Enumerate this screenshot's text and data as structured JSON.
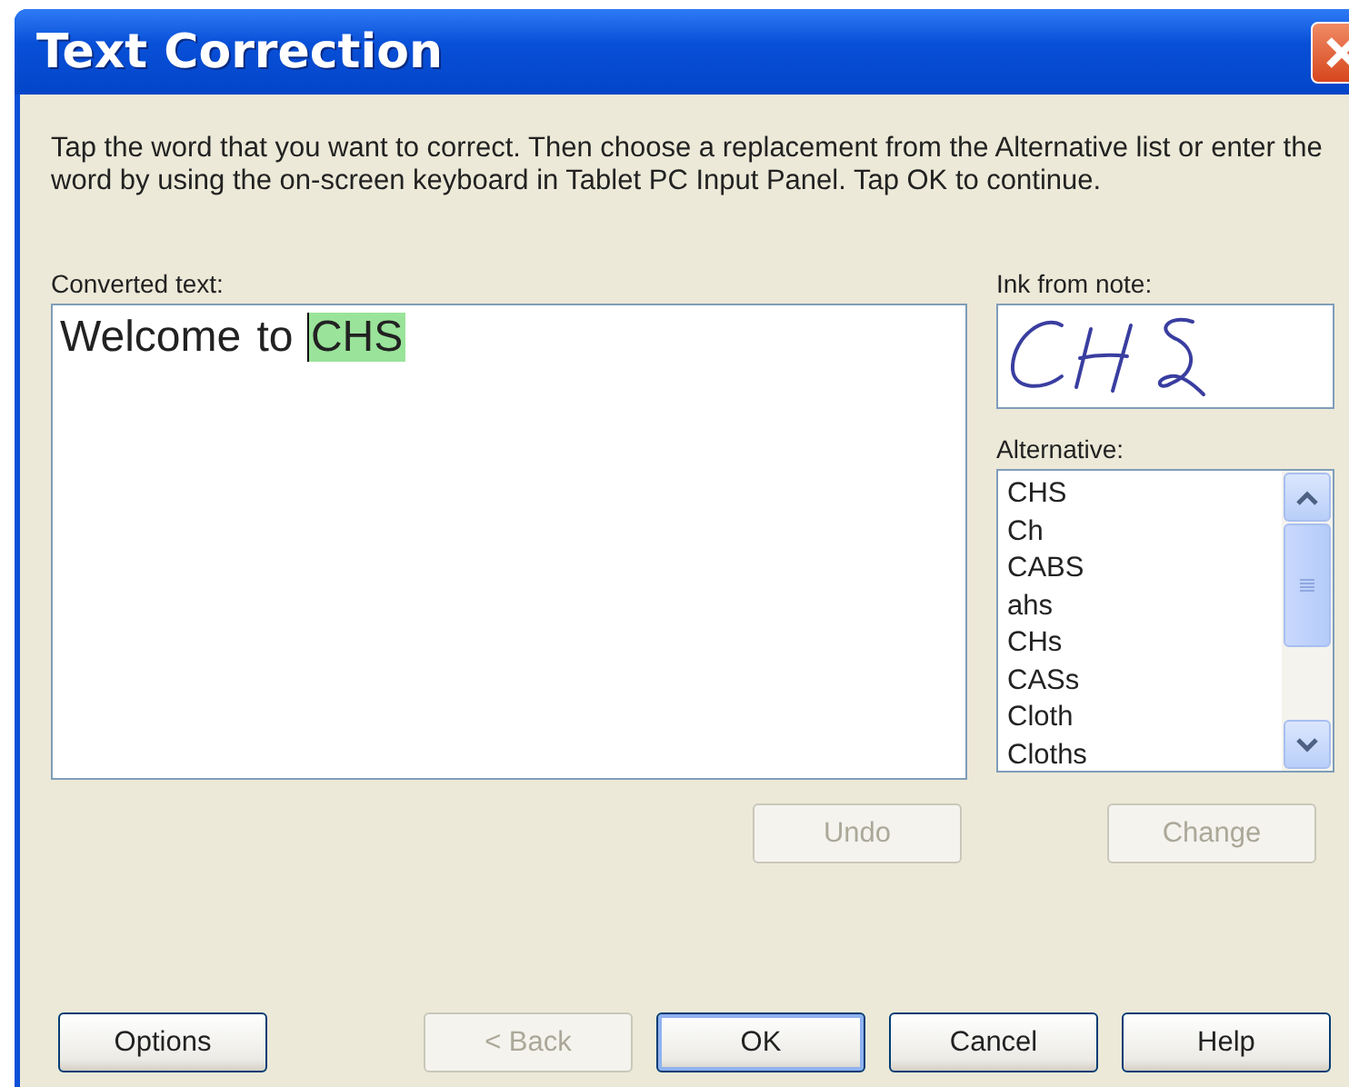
{
  "window": {
    "title": "Text Correction"
  },
  "instructions": "Tap the word that you want to correct. Then choose a replacement from the Alternative list or enter the word by using the on-screen keyboard in Tablet PC Input Panel. Tap OK to continue.",
  "converted_text": {
    "label": "Converted text:",
    "words": [
      {
        "text": "Welcome",
        "selected": false
      },
      {
        "text": "to",
        "selected": false
      },
      {
        "text": "CHS",
        "selected": true
      }
    ]
  },
  "ink": {
    "label": "Ink from note:"
  },
  "alternative": {
    "label": "Alternative:",
    "items": [
      {
        "text": "CHS",
        "selected": false
      },
      {
        "text": "Ch",
        "selected": false
      },
      {
        "text": "CABS",
        "selected": false
      },
      {
        "text": "ahs",
        "selected": false
      },
      {
        "text": "CHs",
        "selected": false
      },
      {
        "text": "CASs",
        "selected": false
      },
      {
        "text": "Cloth",
        "selected": false
      },
      {
        "text": "Cloths",
        "selected": false
      }
    ]
  },
  "undo_button": {
    "label": "Undo",
    "disabled": true
  },
  "change_button": {
    "label": "Change",
    "disabled": true
  },
  "buttons": [
    {
      "label": "Options",
      "disabled": false,
      "default": false
    },
    {
      "label": "< Back",
      "disabled": true,
      "default": false
    },
    {
      "label": "OK",
      "disabled": false,
      "default": true
    },
    {
      "label": "Cancel",
      "disabled": false,
      "default": false
    },
    {
      "label": "Help",
      "disabled": false,
      "default": false
    }
  ]
}
